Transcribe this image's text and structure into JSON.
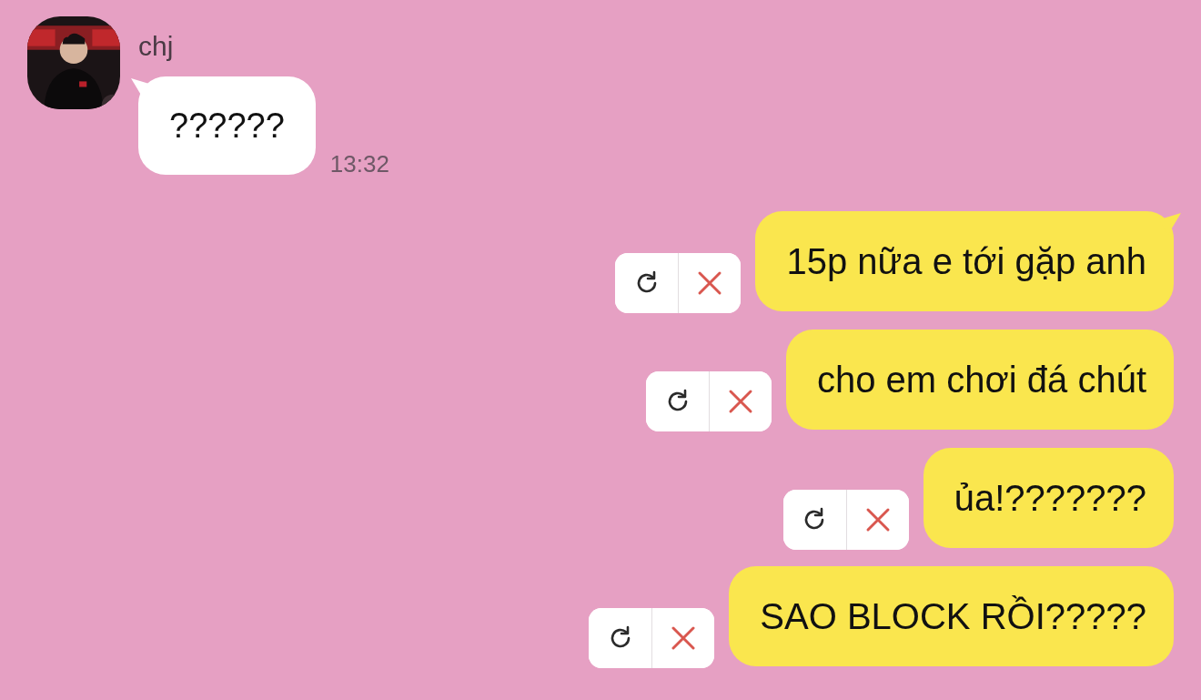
{
  "incoming": {
    "sender": "chj",
    "messages": [
      {
        "text": "??????",
        "time": "13:32"
      }
    ]
  },
  "outgoing": [
    {
      "text": "15p nữa e tới gặp anh"
    },
    {
      "text": "cho em chơi đá chút"
    },
    {
      "text": "ủa!???????"
    },
    {
      "text": "SAO BLOCK RỒI?????"
    }
  ]
}
